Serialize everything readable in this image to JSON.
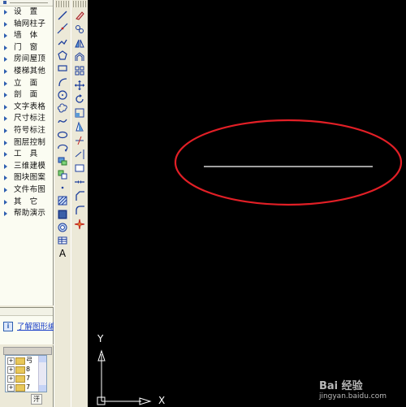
{
  "screen_menu": {
    "items": [
      {
        "label": "设　置",
        "wide": true
      },
      {
        "label": "轴网柱子",
        "wide": false
      },
      {
        "label": "墙　体",
        "wide": true
      },
      {
        "label": "门　窗",
        "wide": true
      },
      {
        "label": "房间屋顶",
        "wide": false
      },
      {
        "label": "楼梯其他",
        "wide": false
      },
      {
        "label": "立　面",
        "wide": true
      },
      {
        "label": "剖　面",
        "wide": true
      },
      {
        "label": "文字表格",
        "wide": false
      },
      {
        "label": "尺寸标注",
        "wide": false
      },
      {
        "label": "符号标注",
        "wide": false
      },
      {
        "label": "图层控制",
        "wide": false
      },
      {
        "label": "工　具",
        "wide": true
      },
      {
        "label": "三维建模",
        "wide": false
      },
      {
        "label": "图块图案",
        "wide": false
      },
      {
        "label": "文件布图",
        "wide": false
      },
      {
        "label": "其　它",
        "wide": true
      },
      {
        "label": "帮助演示",
        "wide": false
      }
    ]
  },
  "help_panel": {
    "info_icon": "i",
    "link_text": "了解图形编"
  },
  "tree_panel": {
    "rows": [
      {
        "plus": "+",
        "text": "弓"
      },
      {
        "plus": "+",
        "text": "8"
      },
      {
        "plus": "+",
        "text": "7"
      },
      {
        "plus": "+",
        "text": "7"
      }
    ],
    "tab_text": "汗"
  },
  "toolbars": {
    "draw": [
      "line-icon",
      "construction-line-icon",
      "polyline-icon",
      "polygon-icon",
      "rectangle-icon",
      "arc-icon",
      "circle-icon",
      "revision-cloud-icon",
      "spline-icon",
      "ellipse-icon",
      "ellipse-arc-icon",
      "insert-block-icon",
      "make-block-icon",
      "point-icon",
      "hatch-icon",
      "gradient-icon",
      "region-icon",
      "table-icon",
      "multiline-text-icon"
    ],
    "modify": [
      "erase-icon",
      "copy-icon",
      "mirror-icon",
      "offset-icon",
      "array-icon",
      "move-icon",
      "rotate-icon",
      "scale-icon",
      "stretch-icon",
      "trim-icon",
      "extend-icon",
      "break-icon",
      "join-icon",
      "chamfer-icon",
      "fillet-icon",
      "explode-icon"
    ],
    "text_tool_glyph": "A"
  },
  "canvas": {
    "background": "#000000",
    "highlight_color": "#e21f26",
    "line_color": "#ffffff",
    "ucs": {
      "x_label": "X",
      "y_label": "Y"
    },
    "watermark": {
      "brand": "Bai 经验",
      "sub": "jingyan.baidu.com"
    }
  }
}
